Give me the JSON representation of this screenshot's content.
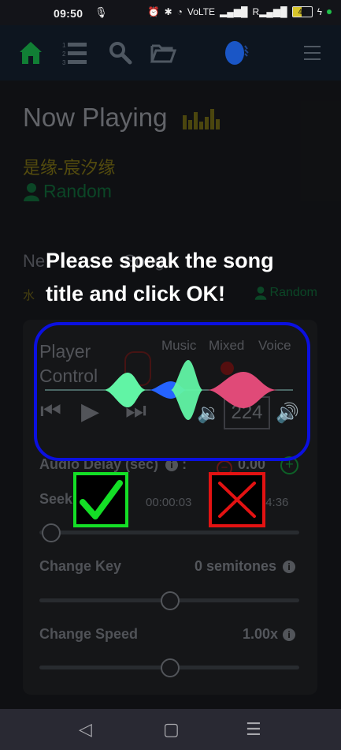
{
  "status_bar": {
    "time": "09:50",
    "battery_level": "49",
    "network": "VoLTE"
  },
  "navigation": {
    "items": [
      {
        "name": "home",
        "icon": "home-icon"
      },
      {
        "name": "queue",
        "icon": "numbered-list-icon"
      },
      {
        "name": "search",
        "icon": "search-icon"
      },
      {
        "name": "open-folder",
        "icon": "folder-open-icon"
      },
      {
        "name": "voice-search",
        "icon": "voice-search-icon"
      },
      {
        "name": "menu",
        "icon": "hamburger-menu-icon"
      }
    ]
  },
  "now_playing": {
    "title": "Now Playing",
    "song": "是缘-宸汐缘",
    "singer": "Random"
  },
  "next_song": {
    "label": "Next Song",
    "visible_label": "Ne",
    "visible_label_tail": "Song",
    "title_visible": "水",
    "singer": "Random"
  },
  "player_control": {
    "title_line1": "Player",
    "title_line2": "Control",
    "modes": [
      "Music",
      "Mixed",
      "Voice"
    ],
    "volume": "224",
    "audio_delay_label": "Audio Delay (sec)",
    "audio_delay_suffix": ":",
    "audio_delay_value": "0.00",
    "seek_label": "Seek To",
    "seek_current": "00:00:03",
    "seek_total": "00:04:36",
    "seek_fraction": 0.01,
    "change_key_label": "Change Key",
    "change_key_value": "0 semitones",
    "change_key_fraction": 0.5,
    "change_speed_label": "Change Speed",
    "change_speed_value": "1.00x",
    "change_speed_fraction": 0.5
  },
  "voice_prompt": {
    "text_line1": "Please speak the song",
    "text_line2": "title and click OK!",
    "ok_label": "OK",
    "cancel_label": "Cancel"
  },
  "colors": {
    "accent_blue": "#0b10e0",
    "ok_green": "#14df26",
    "cancel_red": "#e31212",
    "wave_green": "#61f4a5",
    "wave_blue": "#2563ff",
    "wave_pink": "#e04a78"
  }
}
